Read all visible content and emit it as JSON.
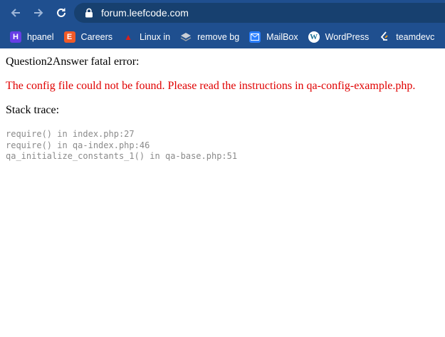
{
  "browser": {
    "url": "forum.leefcode.com",
    "bookmarks": [
      {
        "label": "hpanel",
        "icon": "hpanel-icon",
        "color": "#673de6"
      },
      {
        "label": "Careers",
        "icon": "careers-icon",
        "color": "#f05a28"
      },
      {
        "label": "Linux in",
        "icon": "linux-icon",
        "color": "#d9201a"
      },
      {
        "label": "remove bg",
        "icon": "remove-bg-icon",
        "color": "#9aa0a6"
      },
      {
        "label": "MailBox",
        "icon": "mail-icon",
        "color": "#2a7fff"
      },
      {
        "label": "WordPress",
        "icon": "wordpress-icon",
        "color": "#21759b"
      },
      {
        "label": "teamdevc",
        "icon": "teamdevc-icon",
        "color": "#ffffff"
      }
    ]
  },
  "page": {
    "fatal_title": "Question2Answer fatal error:",
    "error_message": "The config file could not be found. Please read the instructions in qa-config-example.php.",
    "stack_heading": "Stack trace:",
    "stack_trace": [
      "require() in index.php:27",
      "require() in qa-index.php:46",
      "qa_initialize_constants_1() in qa-base.php:51"
    ]
  }
}
